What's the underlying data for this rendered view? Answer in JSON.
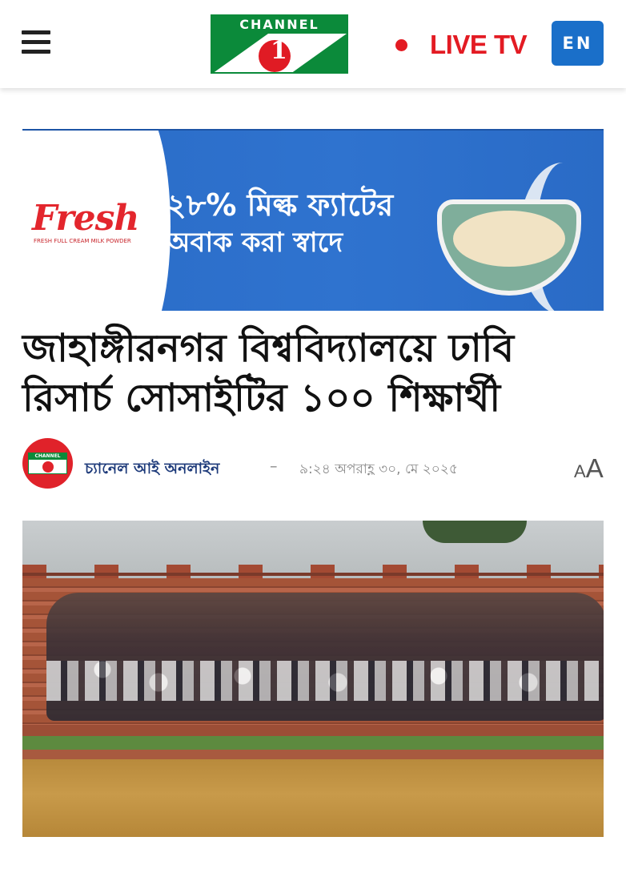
{
  "header": {
    "logo_text": "CHANNEL",
    "logo_numeral": "1",
    "live_label": "LIVE TV",
    "lang_label": "EN"
  },
  "ad": {
    "brand": "Fresh",
    "tagline": "FRESH FULL CREAM MILK POWDER",
    "line1": "২৮% মিল্ক ফ্যাটের",
    "line2": "অবাক করা স্বাদে"
  },
  "article": {
    "headline": "জাহাঙ্গীরনগর বিশ্ববিদ্যালয়ে ঢাবি রিসার্চ সোসাইটির ১০০ শিক্ষার্থী",
    "author": "চ্যানেল আই অনলাইন",
    "separator": "–",
    "published": "৯:২৪ অপরাহ্ণ ৩০, মে ২০২৫",
    "font_small": "A",
    "font_large": "A"
  },
  "colors": {
    "brand_green": "#0b8a3a",
    "brand_red": "#e31b23",
    "lang_button": "#1a6fc9",
    "author_text": "#1d3a7a"
  },
  "icons": {
    "menu": "hamburger-menu-icon",
    "live": "live-dot-icon",
    "text_size": "text-size-icon"
  }
}
